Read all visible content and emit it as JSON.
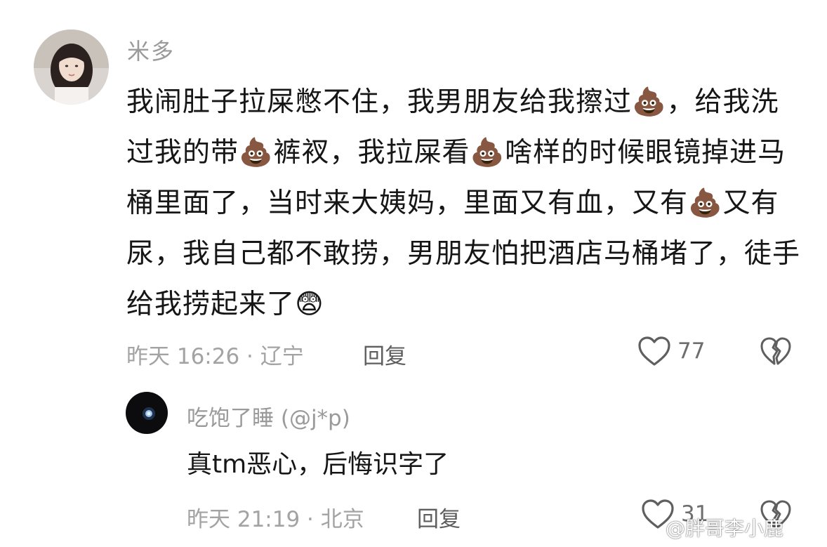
{
  "comments": [
    {
      "username": "米多",
      "avatar_icon": "avatar-girl-photo",
      "content": "我闹肚子拉屎憋不住，我男朋友给我擦过💩，给我洗过我的带💩裤衩，我拉屎看💩啥样的时候眼镜掉进马桶里面了，当时来大姨妈，里面又有血，又有💩又有尿，我自己都不敢捞，男朋友怕把酒店马桶堵了，徒手给我捞起来了😨",
      "meta": "昨天 16:26 · 辽宁",
      "reply_label": "回复",
      "like_count": "77",
      "like_icon": "heart-icon",
      "dislike_icon": "broken-heart-icon"
    },
    {
      "username": "吃饱了睡 (@j*p)",
      "avatar_icon": "avatar-dark-moon",
      "content": "真tm恶心，后悔识字了",
      "meta": "昨天 21:19 · 北京",
      "reply_label": "回复",
      "like_count": "31",
      "like_icon": "heart-icon",
      "dislike_icon": "broken-heart-icon"
    }
  ],
  "watermark": "@胖哥李小鹿",
  "colors": {
    "text_primary": "#161616",
    "text_secondary": "#9a9a9a",
    "reply_text": "#5e5e5e",
    "background": "#ffffff"
  }
}
